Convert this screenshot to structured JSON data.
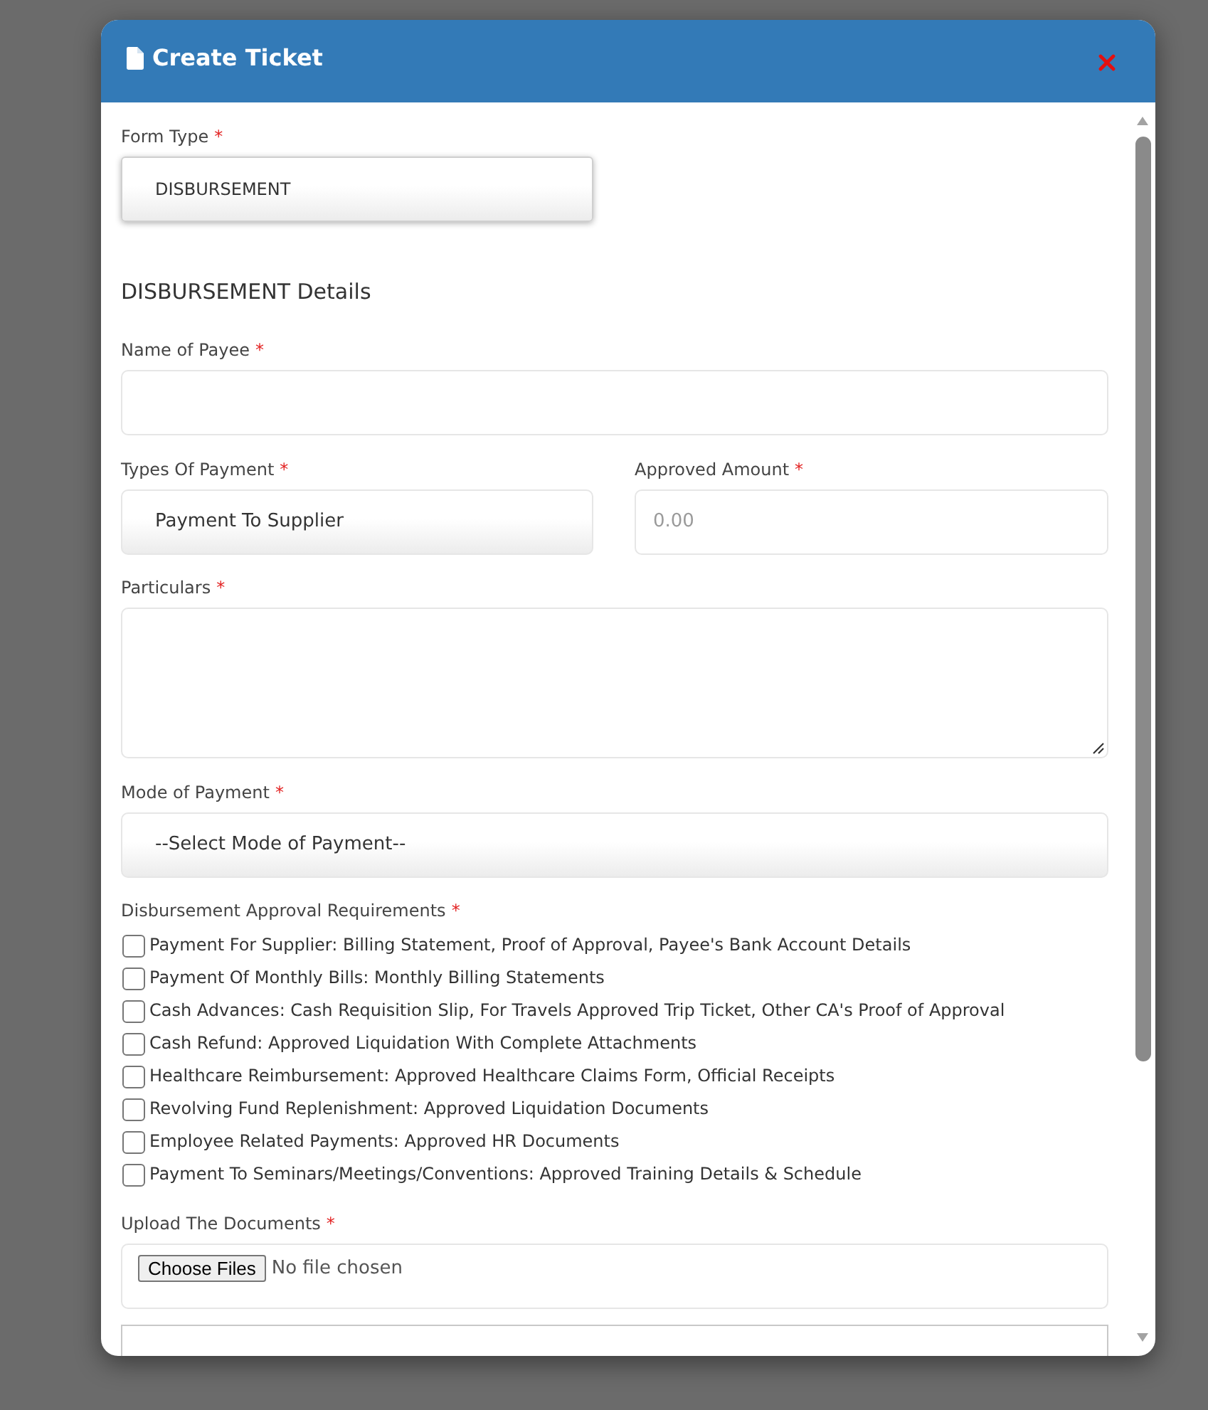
{
  "modal": {
    "title": "Create Ticket"
  },
  "form_type": {
    "label": "Form Type",
    "required_mark": "*",
    "value": "DISBURSEMENT"
  },
  "section_title": "DISBURSEMENT Details",
  "rows": [
    [
      {
        "kind": "text",
        "label": "Name of Payee",
        "required_mark": "*"
      }
    ],
    [
      {
        "kind": "select",
        "label": "Types Of Payment",
        "required_mark": "*",
        "value": "Payment To Supplier"
      },
      {
        "kind": "text",
        "label": "Approved Amount",
        "required_mark": "*",
        "placeholder": "0.00"
      }
    ],
    [
      {
        "kind": "textarea",
        "label": "Particulars",
        "required_mark": "*"
      }
    ],
    [
      {
        "kind": "select",
        "label": "Mode of Payment",
        "required_mark": "*",
        "value": "--Select Mode of Payment--"
      }
    ]
  ],
  "requirements": {
    "label": "Disbursement Approval Requirements",
    "required_mark": "*",
    "items": [
      {
        "text": "Payment For Supplier: Billing Statement, Proof of Approval, Payee's Bank Account Details",
        "checked": false
      },
      {
        "text": "Payment Of Monthly Bills: Monthly Billing Statements",
        "checked": false
      },
      {
        "text": "Cash Advances: Cash Requisition Slip, For Travels Approved Trip Ticket, Other CA's Proof of Approval",
        "checked": false
      },
      {
        "text": "Cash Refund: Approved Liquidation With Complete Attachments",
        "checked": false
      },
      {
        "text": "Healthcare Reimbursement: Approved Healthcare Claims Form, Official Receipts",
        "checked": false
      },
      {
        "text": "Revolving Fund Replenishment: Approved Liquidation Documents",
        "checked": false
      },
      {
        "text": "Employee Related Payments: Approved HR Documents",
        "checked": false
      },
      {
        "text": "Payment To Seminars/Meetings/Conventions: Approved Training Details & Schedule",
        "checked": false
      }
    ]
  },
  "upload": {
    "label": "Upload The Documents",
    "required_mark": "*",
    "button": "Choose Files",
    "status": "No file chosen"
  },
  "next_field": {
    "kind": "text"
  }
}
